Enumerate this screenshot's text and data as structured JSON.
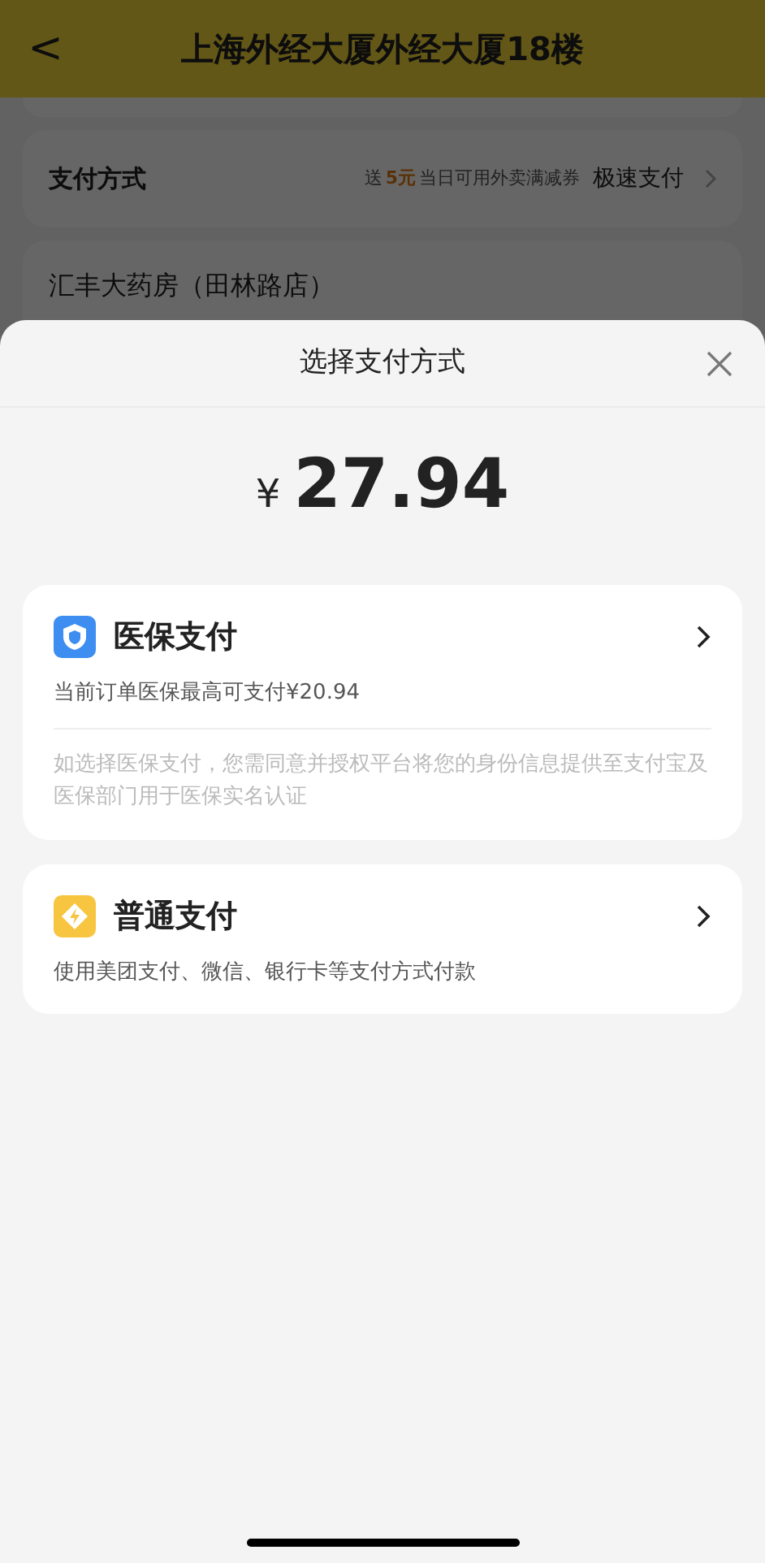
{
  "header": {
    "back": "<",
    "title": "上海外经大厦外经大厦18楼"
  },
  "payment_row": {
    "label": "支付方式",
    "promo_prefix": "送",
    "promo_amount": "5元",
    "promo_suffix": "当日可用外卖满减券",
    "value": "极速支付"
  },
  "store": {
    "name": "汇丰大药房（田林路店）"
  },
  "sheet": {
    "title": "选择支付方式",
    "currency": "¥",
    "amount": "27.94",
    "options": [
      {
        "kind": "medical",
        "title": "医保支付",
        "subtitle": "当前订单医保最高可支付¥20.94",
        "note": "如选择医保支付，您需同意并授权平台将您的身份信息提供至支付宝及医保部门用于医保实名认证"
      },
      {
        "kind": "general",
        "title": "普通支付",
        "subtitle": "使用美团支付、微信、银行卡等支付方式付款"
      }
    ]
  }
}
